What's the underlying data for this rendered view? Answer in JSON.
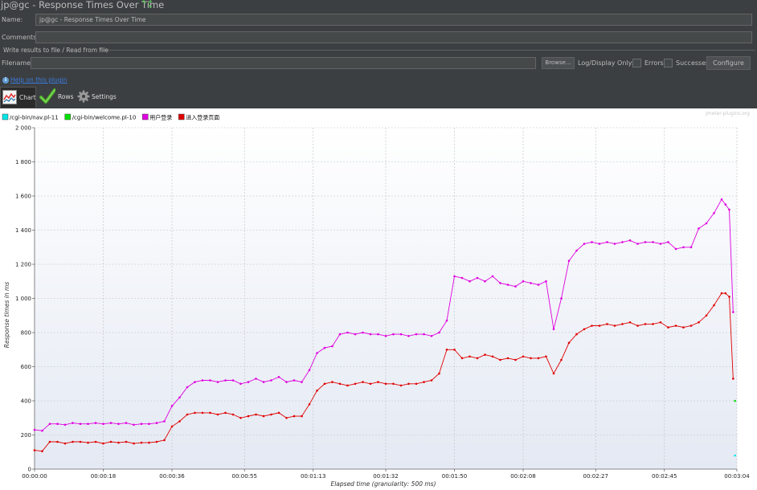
{
  "window": {
    "title": "jp@gc - Response Times Over Time"
  },
  "form": {
    "name_label": "Name:",
    "name_value": "jp@gc - Response Times Over Time",
    "comments_label": "Comments:",
    "comments_value": "",
    "file_section_legend": "Write results to file / Read from file",
    "filename_label": "Filename",
    "filename_value": "",
    "browse_label": "Browse...",
    "log_display_label": "Log/Display Only:",
    "errors_label": "Errors",
    "successes_label": "Successes",
    "configure_label": "Configure"
  },
  "help": {
    "link_text": "Help on this plugin"
  },
  "tabs": [
    {
      "label": "Chart",
      "icon": "chart-icon",
      "active": true
    },
    {
      "label": "Rows",
      "icon": "checkmark-icon",
      "active": false
    },
    {
      "label": "Settings",
      "icon": "gear-icon",
      "active": false
    }
  ],
  "colors": {
    "series_nav": "#00e5e5",
    "series_welcome": "#00e000",
    "series_user_login": "#e000e0",
    "series_enter_login_page": "#e00000",
    "plot_bg_top": "#ffffff",
    "plot_bg_bottom": "#e4e9f3"
  },
  "chart_data": {
    "type": "line",
    "watermark": "jmeter-plugins.org",
    "xlabel": "Elapsed time (granularity: 500 ms)",
    "ylabel": "Response times in ms",
    "xlim_seconds": [
      0,
      184
    ],
    "ylim": [
      0,
      2000
    ],
    "grid": true,
    "legend_position": "top-left",
    "y_ticks": [
      {
        "value": 0,
        "label": "0"
      },
      {
        "value": 200,
        "label": "200"
      },
      {
        "value": 400,
        "label": "400"
      },
      {
        "value": 600,
        "label": "600"
      },
      {
        "value": 800,
        "label": "800"
      },
      {
        "value": 1000,
        "label": "1 000"
      },
      {
        "value": 1200,
        "label": "1 200"
      },
      {
        "value": 1400,
        "label": "1 400"
      },
      {
        "value": 1600,
        "label": "1 600"
      },
      {
        "value": 1800,
        "label": "1 800"
      },
      {
        "value": 2000,
        "label": "2 000"
      }
    ],
    "x_ticks": [
      {
        "value": 0,
        "label": "00:00:00"
      },
      {
        "value": 18,
        "label": "00:00:18"
      },
      {
        "value": 36,
        "label": "00:00:36"
      },
      {
        "value": 55,
        "label": "00:00:55"
      },
      {
        "value": 73,
        "label": "00:01:13"
      },
      {
        "value": 92,
        "label": "00:01:32"
      },
      {
        "value": 110,
        "label": "00:01:50"
      },
      {
        "value": 128,
        "label": "00:02:08"
      },
      {
        "value": 147,
        "label": "00:02:27"
      },
      {
        "value": 165,
        "label": "00:02:45"
      },
      {
        "value": 184,
        "label": "00:03:04"
      }
    ],
    "series": [
      {
        "name": "/cgi-bin/nav.pl-11",
        "color": "#00e5e5",
        "points": [
          [
            183.5,
            80
          ]
        ]
      },
      {
        "name": "/cgi-bin/welcome.pl-10",
        "color": "#00e000",
        "points": [
          [
            183.5,
            400
          ]
        ]
      },
      {
        "name": "用户登录",
        "color": "#e000e0",
        "points": [
          [
            0,
            230
          ],
          [
            2,
            225
          ],
          [
            4,
            265
          ],
          [
            6,
            265
          ],
          [
            8,
            260
          ],
          [
            10,
            270
          ],
          [
            12,
            265
          ],
          [
            14,
            265
          ],
          [
            16,
            270
          ],
          [
            18,
            265
          ],
          [
            20,
            270
          ],
          [
            22,
            265
          ],
          [
            24,
            270
          ],
          [
            26,
            260
          ],
          [
            28,
            265
          ],
          [
            30,
            265
          ],
          [
            32,
            270
          ],
          [
            34,
            280
          ],
          [
            36,
            370
          ],
          [
            38,
            420
          ],
          [
            40,
            480
          ],
          [
            42,
            510
          ],
          [
            44,
            520
          ],
          [
            46,
            520
          ],
          [
            48,
            510
          ],
          [
            50,
            520
          ],
          [
            52,
            520
          ],
          [
            54,
            500
          ],
          [
            56,
            510
          ],
          [
            58,
            530
          ],
          [
            60,
            510
          ],
          [
            62,
            520
          ],
          [
            64,
            540
          ],
          [
            66,
            510
          ],
          [
            68,
            520
          ],
          [
            70,
            510
          ],
          [
            72,
            580
          ],
          [
            74,
            680
          ],
          [
            76,
            710
          ],
          [
            78,
            720
          ],
          [
            80,
            790
          ],
          [
            82,
            800
          ],
          [
            84,
            790
          ],
          [
            86,
            800
          ],
          [
            88,
            790
          ],
          [
            90,
            790
          ],
          [
            92,
            780
          ],
          [
            94,
            790
          ],
          [
            96,
            790
          ],
          [
            98,
            780
          ],
          [
            100,
            790
          ],
          [
            102,
            790
          ],
          [
            104,
            780
          ],
          [
            106,
            800
          ],
          [
            108,
            870
          ],
          [
            110,
            1130
          ],
          [
            112,
            1120
          ],
          [
            114,
            1100
          ],
          [
            116,
            1120
          ],
          [
            118,
            1100
          ],
          [
            120,
            1130
          ],
          [
            122,
            1090
          ],
          [
            124,
            1080
          ],
          [
            126,
            1070
          ],
          [
            128,
            1100
          ],
          [
            130,
            1090
          ],
          [
            132,
            1080
          ],
          [
            134,
            1100
          ],
          [
            136,
            820
          ],
          [
            138,
            1000
          ],
          [
            140,
            1220
          ],
          [
            142,
            1280
          ],
          [
            144,
            1320
          ],
          [
            146,
            1330
          ],
          [
            148,
            1320
          ],
          [
            150,
            1330
          ],
          [
            152,
            1320
          ],
          [
            154,
            1330
          ],
          [
            156,
            1340
          ],
          [
            158,
            1320
          ],
          [
            160,
            1330
          ],
          [
            162,
            1330
          ],
          [
            164,
            1320
          ],
          [
            166,
            1330
          ],
          [
            168,
            1290
          ],
          [
            170,
            1300
          ],
          [
            172,
            1300
          ],
          [
            174,
            1410
          ],
          [
            176,
            1440
          ],
          [
            178,
            1500
          ],
          [
            180,
            1580
          ],
          [
            181,
            1550
          ],
          [
            182,
            1520
          ],
          [
            183,
            920
          ]
        ]
      },
      {
        "name": "进入登录页面",
        "color": "#e00000",
        "points": [
          [
            0,
            110
          ],
          [
            2,
            105
          ],
          [
            4,
            160
          ],
          [
            6,
            160
          ],
          [
            8,
            150
          ],
          [
            10,
            160
          ],
          [
            12,
            160
          ],
          [
            14,
            155
          ],
          [
            16,
            160
          ],
          [
            18,
            150
          ],
          [
            20,
            160
          ],
          [
            22,
            155
          ],
          [
            24,
            160
          ],
          [
            26,
            150
          ],
          [
            28,
            155
          ],
          [
            30,
            155
          ],
          [
            32,
            160
          ],
          [
            34,
            170
          ],
          [
            36,
            250
          ],
          [
            38,
            280
          ],
          [
            40,
            320
          ],
          [
            42,
            330
          ],
          [
            44,
            330
          ],
          [
            46,
            330
          ],
          [
            48,
            320
          ],
          [
            50,
            330
          ],
          [
            52,
            320
          ],
          [
            54,
            300
          ],
          [
            56,
            310
          ],
          [
            58,
            320
          ],
          [
            60,
            310
          ],
          [
            62,
            320
          ],
          [
            64,
            330
          ],
          [
            66,
            300
          ],
          [
            68,
            310
          ],
          [
            70,
            310
          ],
          [
            72,
            380
          ],
          [
            74,
            460
          ],
          [
            76,
            500
          ],
          [
            78,
            510
          ],
          [
            80,
            500
          ],
          [
            82,
            490
          ],
          [
            84,
            500
          ],
          [
            86,
            510
          ],
          [
            88,
            500
          ],
          [
            90,
            510
          ],
          [
            92,
            500
          ],
          [
            94,
            500
          ],
          [
            96,
            490
          ],
          [
            98,
            500
          ],
          [
            100,
            500
          ],
          [
            102,
            510
          ],
          [
            104,
            520
          ],
          [
            106,
            560
          ],
          [
            108,
            700
          ],
          [
            110,
            700
          ],
          [
            112,
            650
          ],
          [
            114,
            660
          ],
          [
            116,
            650
          ],
          [
            118,
            670
          ],
          [
            120,
            660
          ],
          [
            122,
            640
          ],
          [
            124,
            650
          ],
          [
            126,
            640
          ],
          [
            128,
            660
          ],
          [
            130,
            650
          ],
          [
            132,
            650
          ],
          [
            134,
            660
          ],
          [
            136,
            560
          ],
          [
            138,
            640
          ],
          [
            140,
            740
          ],
          [
            142,
            790
          ],
          [
            144,
            820
          ],
          [
            146,
            840
          ],
          [
            148,
            840
          ],
          [
            150,
            850
          ],
          [
            152,
            840
          ],
          [
            154,
            850
          ],
          [
            156,
            860
          ],
          [
            158,
            840
          ],
          [
            160,
            850
          ],
          [
            162,
            850
          ],
          [
            164,
            860
          ],
          [
            166,
            830
          ],
          [
            168,
            840
          ],
          [
            170,
            830
          ],
          [
            172,
            840
          ],
          [
            174,
            860
          ],
          [
            176,
            900
          ],
          [
            178,
            960
          ],
          [
            180,
            1030
          ],
          [
            181,
            1030
          ],
          [
            182,
            1010
          ],
          [
            183,
            530
          ]
        ]
      }
    ]
  }
}
